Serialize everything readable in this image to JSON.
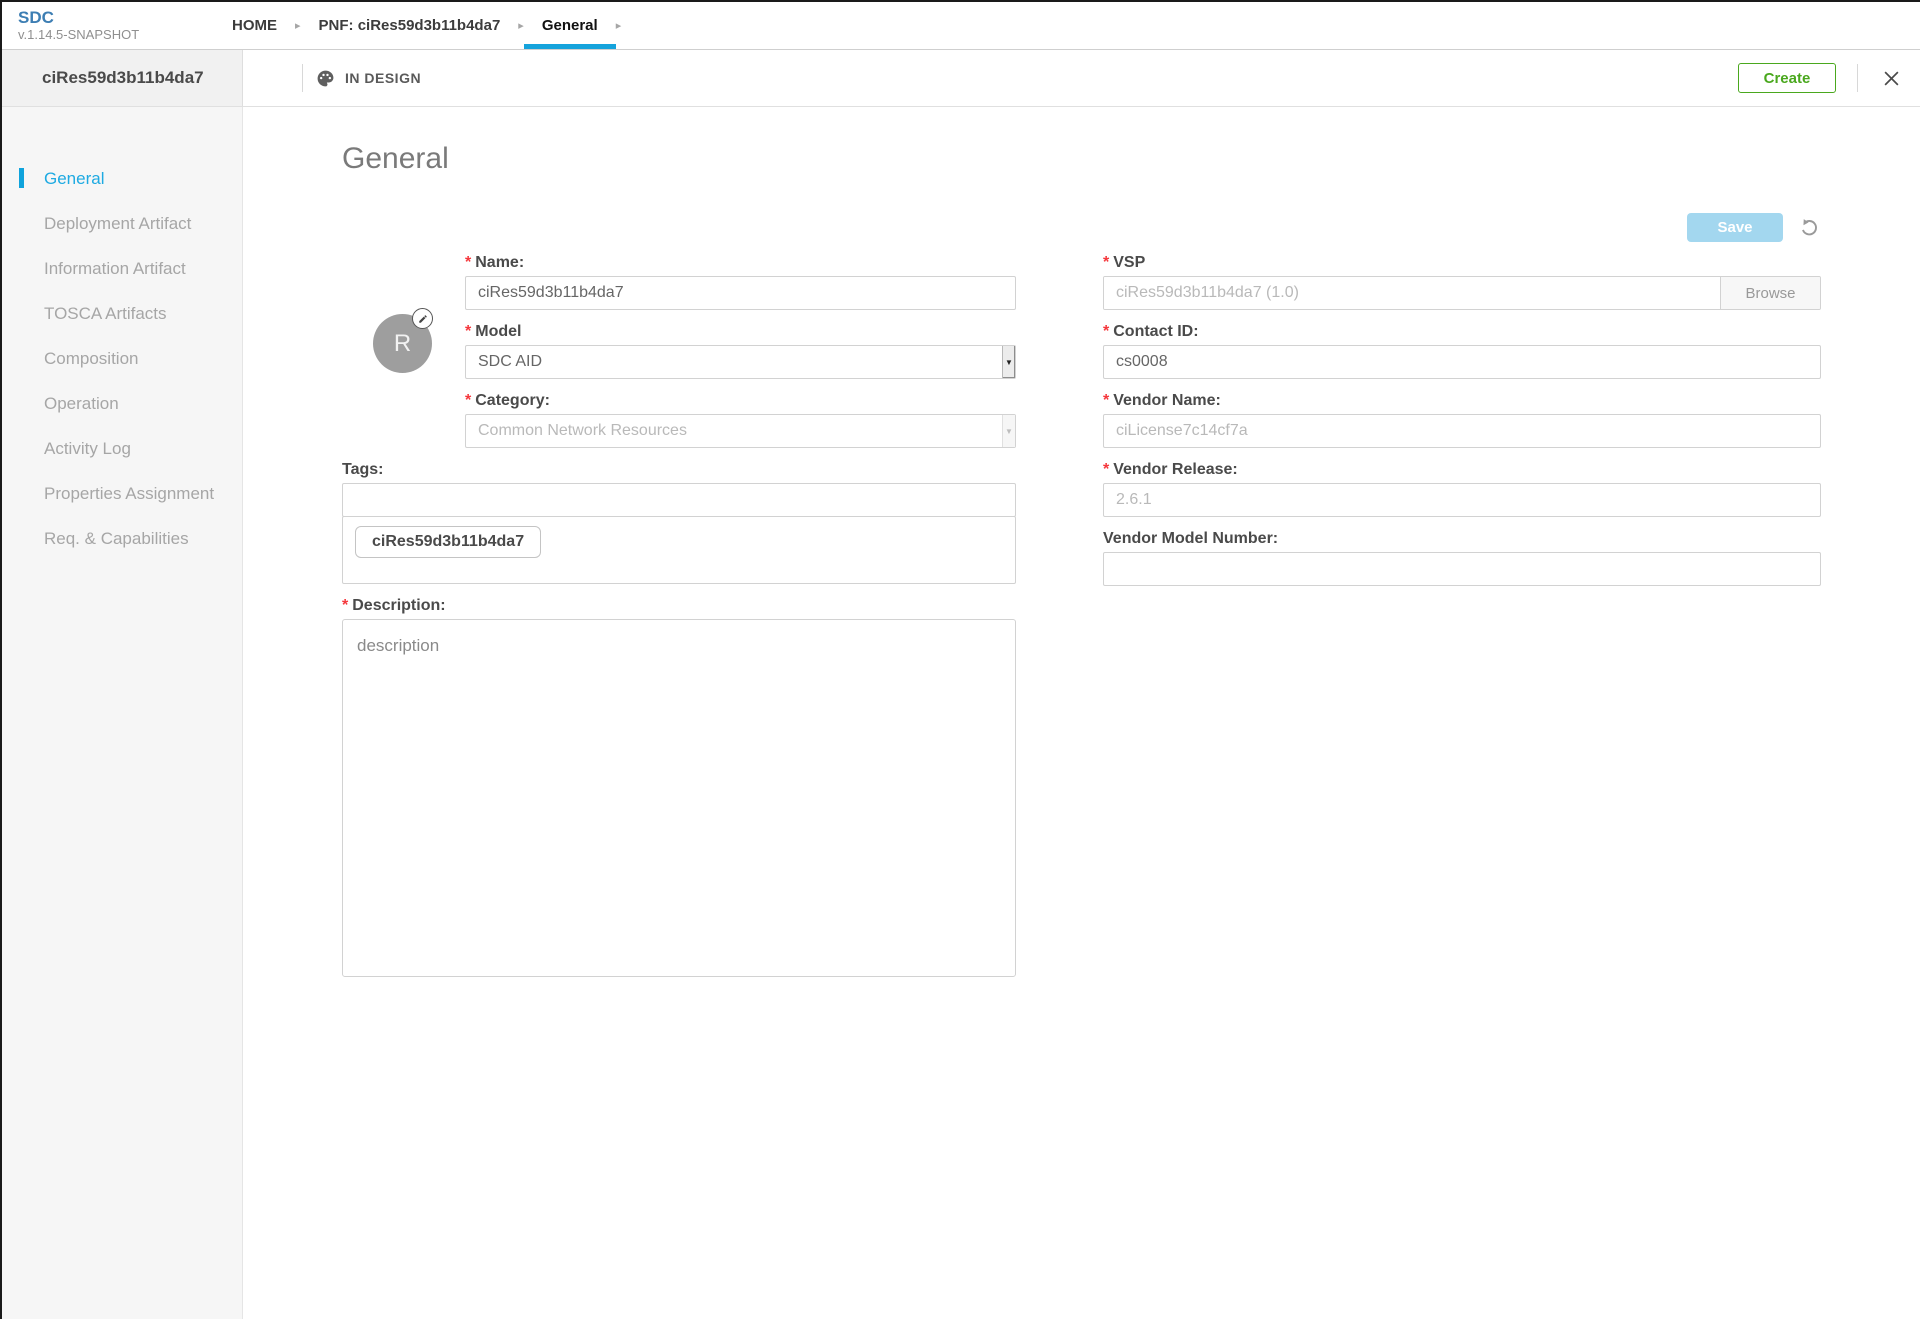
{
  "app": {
    "name": "SDC",
    "version": "v.1.14.5-SNAPSHOT"
  },
  "breadcrumbs": {
    "arrow": "▸",
    "items": [
      {
        "label": "HOME",
        "active": false
      },
      {
        "label": "PNF: ciRes59d3b11b4da7",
        "active": false
      },
      {
        "label": "General",
        "active": true
      }
    ]
  },
  "header": {
    "entity_name": "ciRes59d3b11b4da7",
    "status_label": "IN DESIGN",
    "create_label": "Create"
  },
  "sidebar": {
    "items": [
      {
        "label": "General",
        "active": true
      },
      {
        "label": "Deployment Artifact",
        "active": false
      },
      {
        "label": "Information Artifact",
        "active": false
      },
      {
        "label": "TOSCA Artifacts",
        "active": false
      },
      {
        "label": "Composition",
        "active": false
      },
      {
        "label": "Operation",
        "active": false
      },
      {
        "label": "Activity Log",
        "active": false
      },
      {
        "label": "Properties Assignment",
        "active": false
      },
      {
        "label": "Req. & Capabilities",
        "active": false
      }
    ]
  },
  "general": {
    "title": "General",
    "save_label": "Save",
    "required_marker": "*",
    "avatar_letter": "R",
    "fields": {
      "name": {
        "label": "Name:",
        "value": "ciRes59d3b11b4da7",
        "required": true
      },
      "vsp": {
        "label": "VSP",
        "value": "ciRes59d3b11b4da7 (1.0)",
        "browse_label": "Browse",
        "required": true
      },
      "model": {
        "label": "Model",
        "value": "SDC AID",
        "required": true
      },
      "contact_id": {
        "label": "Contact ID:",
        "value": "cs0008",
        "required": true
      },
      "category": {
        "label": "Category:",
        "value": "Common Network Resources",
        "required": true
      },
      "vendor_name": {
        "label": "Vendor Name:",
        "value": "ciLicense7c14cf7a",
        "required": true
      },
      "vendor_release": {
        "label": "Vendor Release:",
        "value": "2.6.1",
        "required": true
      },
      "vendor_model_number": {
        "label": "Vendor Model Number:",
        "value": "",
        "required": false
      },
      "tags": {
        "label": "Tags:",
        "value": "",
        "chips": [
          "ciRes59d3b11b4da7"
        ],
        "required": false
      },
      "description": {
        "label": "Description:",
        "value": "description",
        "required": true
      }
    }
  },
  "colors": {
    "accent_blue": "#15a3dc",
    "logo_blue": "#3d7eb3",
    "active_item_blue": "#1eaae2",
    "create_green": "#4aa81e",
    "save_disabled_blue": "#a3d7ef",
    "required_red": "#f5373c"
  }
}
